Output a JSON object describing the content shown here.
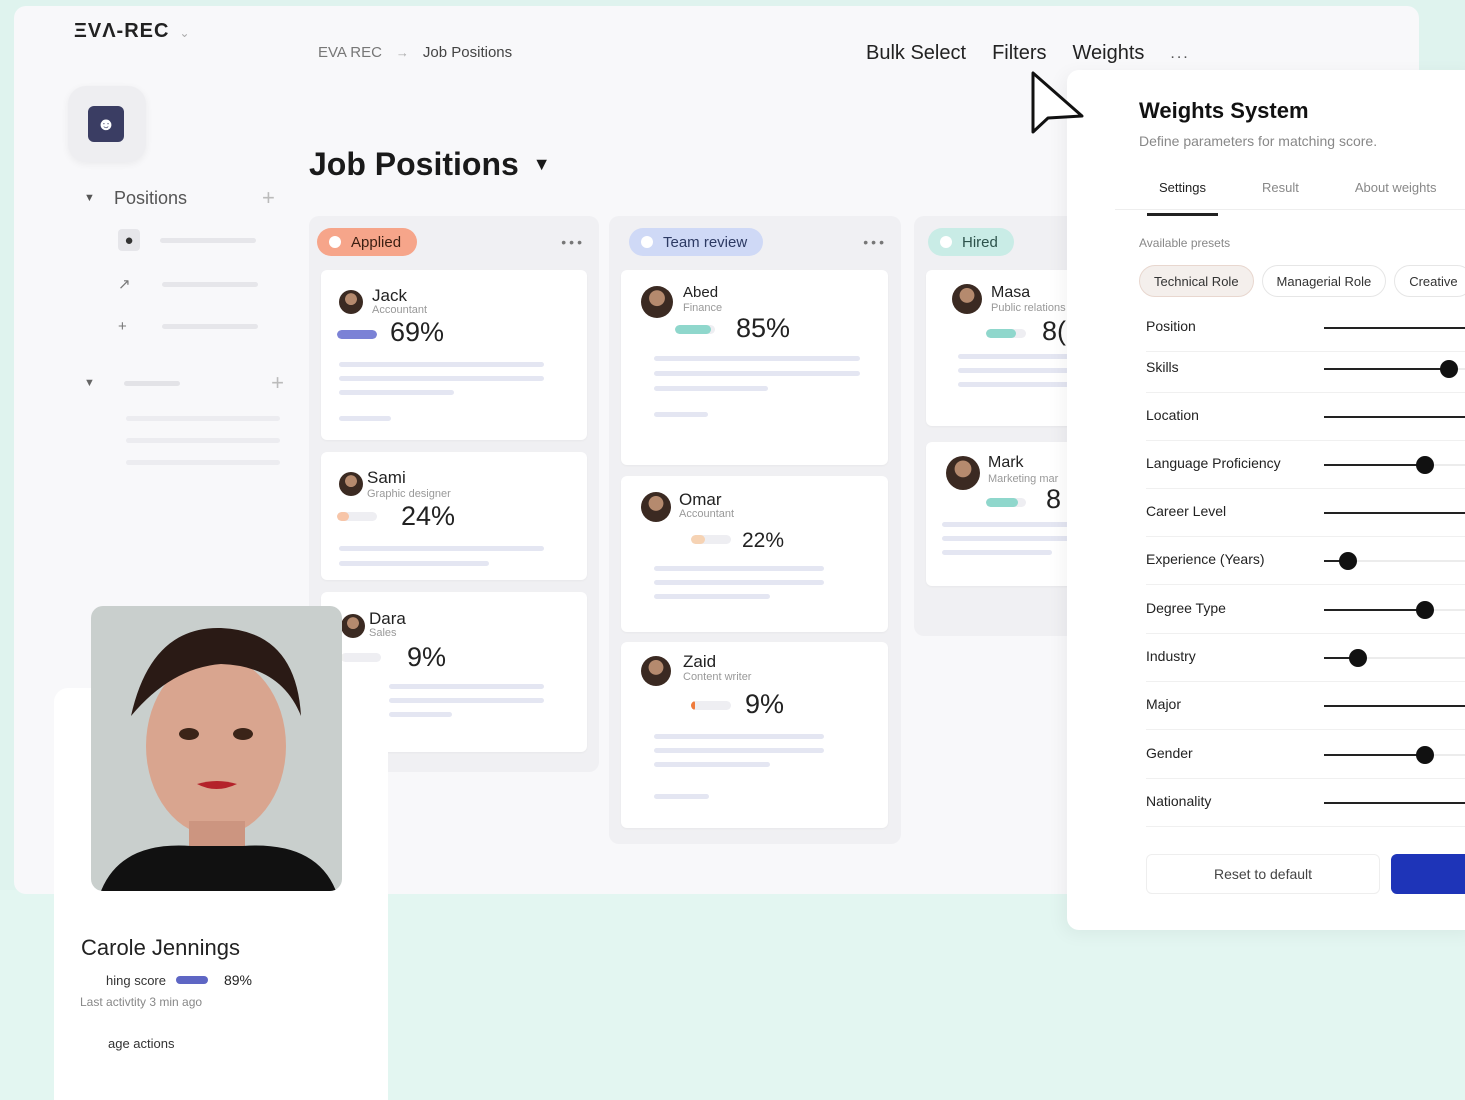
{
  "app": {
    "logo": "ΞVΛ-REC"
  },
  "sidebar": {
    "group_label": "Positions"
  },
  "breadcrumb": {
    "root": "EVA REC",
    "current": "Job Positions"
  },
  "actions": {
    "bulk_select": "Bulk Select",
    "filters": "Filters",
    "weights": "Weights",
    "more": "..."
  },
  "page": {
    "title": "Job Positions"
  },
  "columns": [
    {
      "label": "Applied",
      "color": "#f6a58a",
      "cards": [
        {
          "name": "Jack",
          "role": "Accountant",
          "score": "69%",
          "fraction": 1.0,
          "bar_color": "#7b82d6"
        },
        {
          "name": "Sami",
          "role": "Graphic designer",
          "score": "24%",
          "fraction": 0.3,
          "bar_color": "#f7c5a8"
        },
        {
          "name": "Dara",
          "role": "Sales",
          "score": "9%",
          "fraction": 0.0,
          "bar_color": "#f0f0f0"
        }
      ]
    },
    {
      "label": "Team review",
      "color": "#cfd9f6",
      "cards": [
        {
          "name": "Abed",
          "role": "Finance",
          "score": "85%",
          "fraction": 0.9,
          "bar_color": "#8fd7cc"
        },
        {
          "name": "Omar",
          "role": "Accountant",
          "score": "22%",
          "fraction": 0.35,
          "bar_color": "#f6d3b4"
        },
        {
          "name": "Zaid",
          "role": "Content writer",
          "score": "9%",
          "fraction": 0.1,
          "bar_color": "#ef7b3c"
        }
      ]
    },
    {
      "label": "Hired",
      "color": "#c9ece6",
      "cards": [
        {
          "name": "Masa",
          "role": "Public relations",
          "score": "8(",
          "fraction": 0.75,
          "bar_color": "#8fd7cc"
        },
        {
          "name": "Mark",
          "role": "Marketing mar",
          "score": "8",
          "fraction": 0.8,
          "bar_color": "#8fd7cc"
        }
      ]
    }
  ],
  "weights_panel": {
    "title": "Weights System",
    "subtitle": "Define parameters for matching score.",
    "tabs": [
      "Settings",
      "Result",
      "About weights"
    ],
    "presets_label": "Available presets",
    "presets": [
      "Technical Role",
      "Managerial Role",
      "Creative"
    ],
    "rows": [
      {
        "label": "Position",
        "value": null
      },
      {
        "label": "Skills",
        "value": 0.82
      },
      {
        "label": "Location",
        "value": null
      },
      {
        "label": "Language Proficiency",
        "value": 0.66
      },
      {
        "label": "Career Level",
        "value": null
      },
      {
        "label": "Experience (Years)",
        "value": 0.16
      },
      {
        "label": "Degree Type",
        "value": 0.66
      },
      {
        "label": "Industry",
        "value": 0.22
      },
      {
        "label": "Major",
        "value": null
      },
      {
        "label": "Gender",
        "value": 0.66
      },
      {
        "label": "Nationality",
        "value": null
      }
    ],
    "reset_label": "Reset to default"
  },
  "profile": {
    "name": "Carole Jennings",
    "score_label": "hing score",
    "score_value": "89%",
    "last_activity": "Last activtity 3 min ago",
    "actions_label": "age actions"
  },
  "colors": {
    "accent": "#1e34b8",
    "knob": "#111111"
  }
}
